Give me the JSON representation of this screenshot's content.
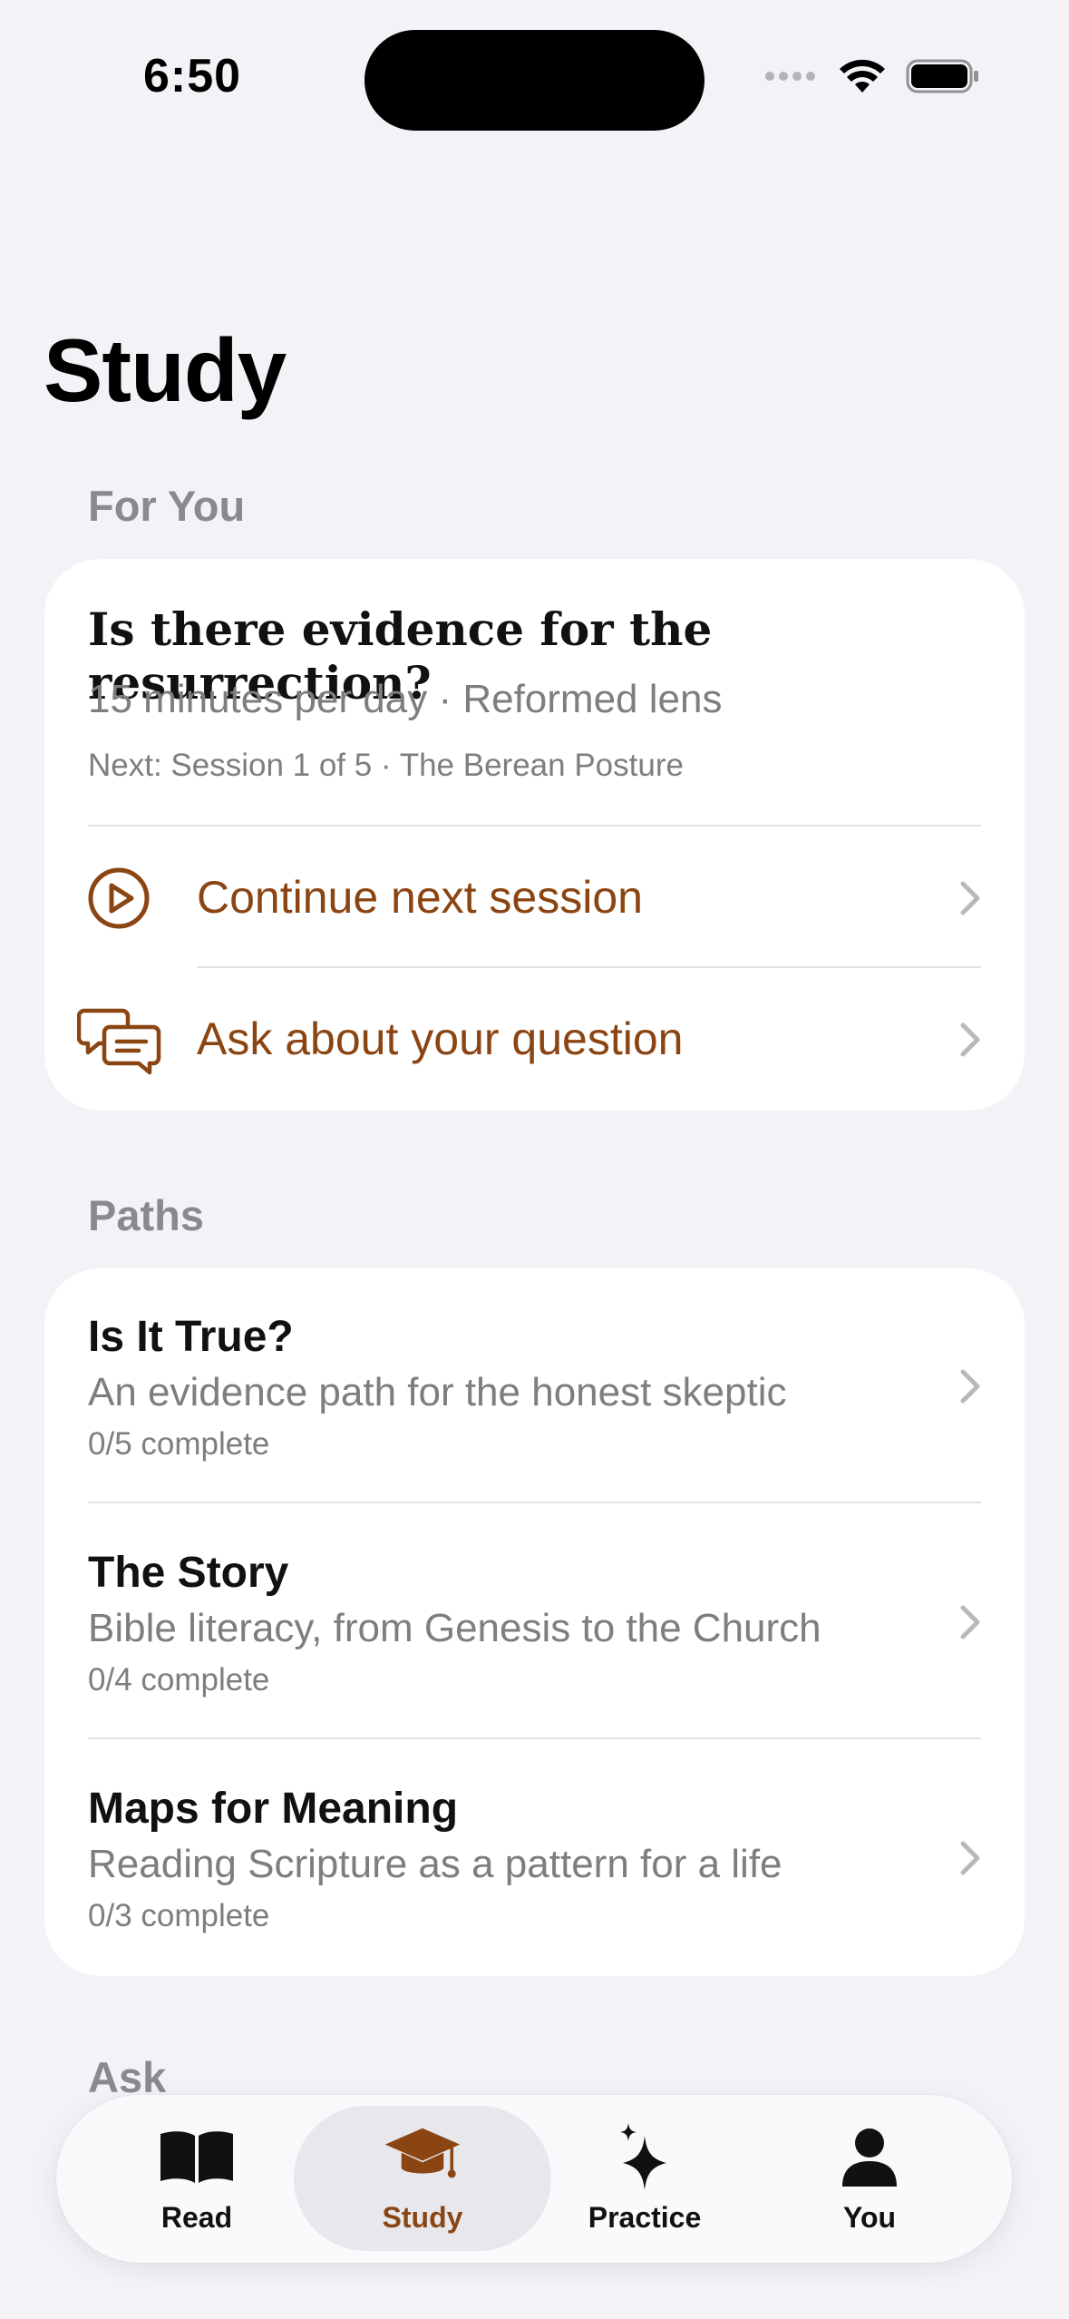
{
  "status": {
    "time": "6:50"
  },
  "page": {
    "title": "Study"
  },
  "for_you": {
    "header": "For You",
    "title": "Is there evidence for the resurrection?",
    "subtitle": "15 minutes per day · Reformed lens",
    "next": "Next: Session 1 of 5 · The Berean Posture",
    "actions": [
      {
        "label": "Continue next session",
        "icon": "play-circle-icon"
      },
      {
        "label": "Ask about your question",
        "icon": "chat-bubbles-icon"
      }
    ]
  },
  "paths": {
    "header": "Paths",
    "items": [
      {
        "title": "Is It True?",
        "description": "An evidence path for the honest skeptic",
        "progress": "0/5 complete"
      },
      {
        "title": "The Story",
        "description": "Bible literacy, from Genesis to the Church",
        "progress": "0/4 complete"
      },
      {
        "title": "Maps for Meaning",
        "description": "Reading Scripture as a pattern for a life",
        "progress": "0/3 complete"
      }
    ]
  },
  "ask": {
    "header": "Ask"
  },
  "tabs": [
    {
      "label": "Read",
      "icon": "book-icon"
    },
    {
      "label": "Study",
      "icon": "graduation-cap-icon",
      "active": true
    },
    {
      "label": "Practice",
      "icon": "sparkles-icon"
    },
    {
      "label": "You",
      "icon": "person-icon"
    }
  ],
  "colors": {
    "accent": "#8b4513",
    "background": "#f2f2f7",
    "secondary_text": "#7d7d82"
  }
}
